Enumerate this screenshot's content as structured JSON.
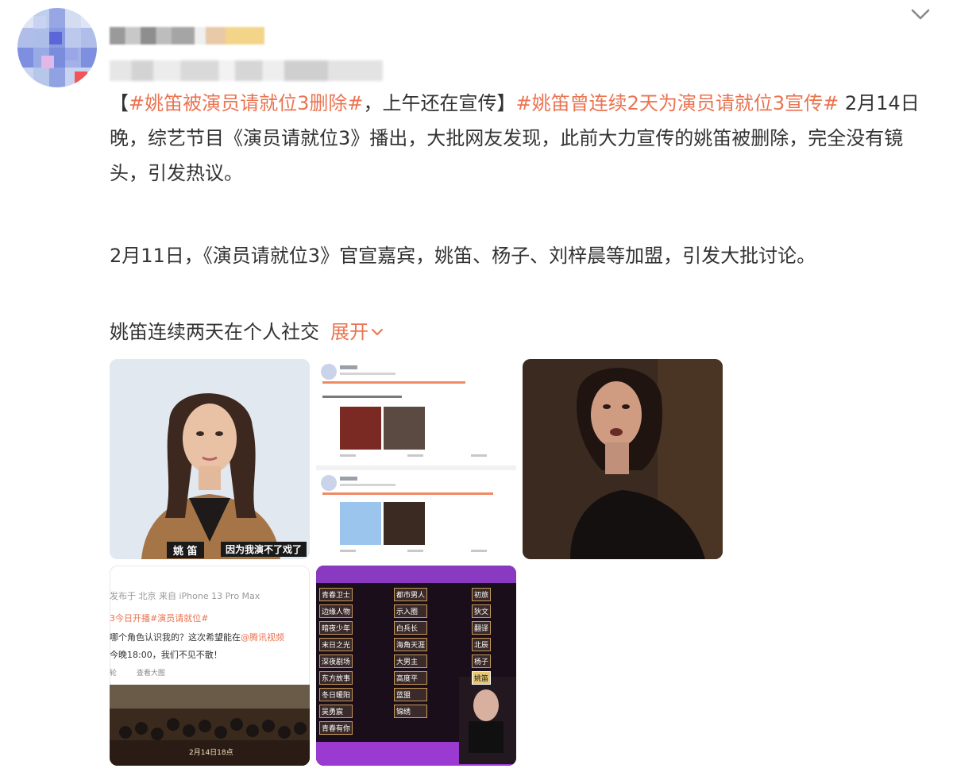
{
  "post": {
    "paragraph1": {
      "open_bracket": "【",
      "hashtag1": "#姚笛被演员请就位3删除#",
      "mid_text": "，上午还在宣传】",
      "hashtag2": "#姚笛曾连续2天为演员请就位3宣传#",
      "body": " 2月14日晚，综艺节目《演员请就位3》播出，大批网友发现，此前大力宣传的姚笛被删除，完全没有镜头，引发热议。"
    },
    "paragraph2": "2月11日，《演员请就位3》官宣嘉宾，姚笛、杨子、刘梓晨等加盟，引发大批讨论。",
    "paragraph3": "姚笛连续两天在个人社交",
    "expand_label": "展开"
  },
  "images": {
    "img1": {
      "name_tag": "姚 笛",
      "subtitle": "因为我演不了戏了"
    },
    "img4": {
      "line1": "发布于 北京 来自 iPhone 13 Pro Max",
      "line2": "3今日开播#演员请就位#",
      "line3": "哪个角色认识我的？这次希望能在",
      "line3_mention": "@腾讯视频",
      "line4": "今晚18:00，我们不见不散！",
      "line5a": "轮",
      "line5b": "查看大图",
      "poster_date": "2月14日18点"
    },
    "img5": {
      "col1": [
        "青春卫士",
        "边缘人物",
        "暗夜少年",
        "末日之光",
        "深夜剧场",
        "东方故事",
        "冬日暖阳",
        "吴勇宸",
        "青春有你"
      ],
      "col2": [
        "都市男人",
        "示入圈",
        "白兵长",
        "海角天涯",
        "大男主",
        "高度平",
        "蓝盟",
        "锦绣"
      ],
      "col3": [
        "初旅",
        "狄文",
        "翻译",
        "北辰",
        "杨子"
      ],
      "highlight": "姚笛"
    }
  },
  "colors": {
    "link": "#eb7350",
    "text": "#333333",
    "chevron": "#8a8a8a"
  },
  "icons": {
    "collapse": "chevron-down-icon",
    "expand": "chevron-down-small-icon"
  }
}
